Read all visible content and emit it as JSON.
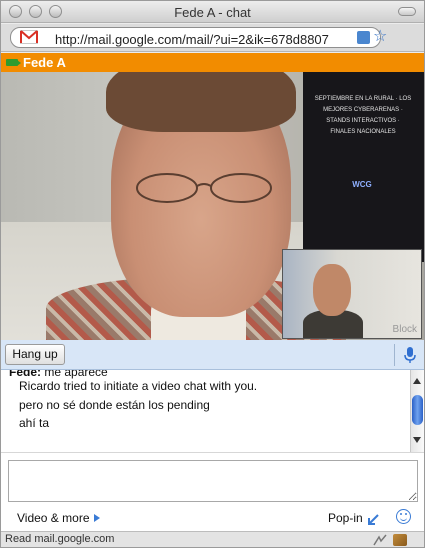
{
  "window": {
    "title": "Fede A - chat"
  },
  "addressbar": {
    "url": "http://mail.google.com/mail/?ui=2&ik=678d8807"
  },
  "chat": {
    "contact_name": "Fede A",
    "video": {
      "poster_text": "SEPTIEMBRE EN LA RURAL · LOS MEJORES CYBERARENAS · STANDS INTERACTIVOS · FINALES NACIONALES",
      "poster_logo": "WCG",
      "self_view_label": "Block"
    },
    "hangup_label": "Hang up",
    "messages": [
      {
        "sender": "Fede:",
        "text": "me aparece"
      },
      {
        "sender": "",
        "text": "Ricardo tried to initiate a video chat with you."
      },
      {
        "sender": "",
        "text": "pero no sé donde están los pending"
      },
      {
        "sender": "",
        "text": "ahí ta"
      }
    ],
    "input_value": "",
    "video_more_label": "Video & more",
    "popin_label": "Pop-in"
  },
  "statusbar": {
    "text": "Read mail.google.com"
  },
  "colors": {
    "header_orange": "#f28c00",
    "hangbar_blue": "#d8e6f7",
    "accent_blue": "#3a7bd5"
  }
}
